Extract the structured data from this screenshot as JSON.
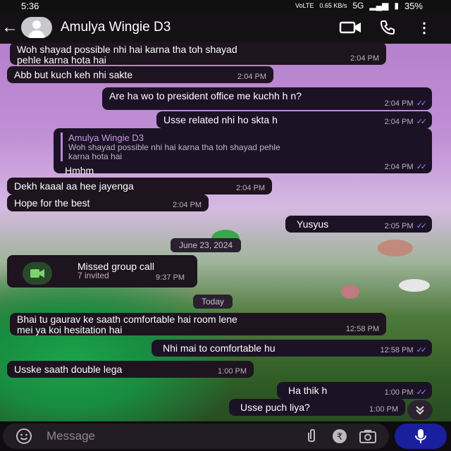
{
  "status_bar": {
    "time": "5:36",
    "network": "5G",
    "speed": "0.65 KB/s",
    "volte": "VoLTE",
    "battery": "35%"
  },
  "header": {
    "contact_name": "Amulya Wingie D3"
  },
  "messages": [
    {
      "text": "Woh shayad possible nhi hai karna tha toh shayad\npehle karna hota hai",
      "time": "2:04 PM"
    },
    {
      "text": "Abb but kuch keh nhi sakte",
      "time": "2:04 PM"
    },
    {
      "text": "Are ha wo to president office me kuchh h n?",
      "time": "2:04 PM"
    },
    {
      "text": "Usse related nhi ho skta h",
      "time": "2:04 PM"
    },
    {
      "quote_name": "Amulya Wingie D3",
      "quote_text": "Woh shayad possible nhi hai karna tha toh shayad pehle\nkarna hota hai",
      "text": "Hmhm",
      "time": "2:04 PM"
    },
    {
      "text": "Dekh kaaal aa hee jayenga",
      "time": "2:04 PM"
    },
    {
      "text": "Hope for the best",
      "time": "2:04 PM"
    },
    {
      "text": "Yusyus",
      "time": "2:05 PM"
    },
    {
      "text": "Bhai tu gaurav ke saath comfortable hai room lene\nmei ya koi hesitation hai",
      "time": "12:58 PM"
    },
    {
      "text": "Nhi mai to comfortable hu",
      "time": "12:58 PM"
    },
    {
      "text": "Usske saath double lega",
      "time": "1:00 PM"
    },
    {
      "text": "Ha thik h",
      "time": "1:00 PM"
    },
    {
      "text": "Usse puch liya?",
      "time": "1:00 PM"
    }
  ],
  "dates": {
    "first": "June 23, 2024",
    "second": "Today"
  },
  "call": {
    "title": "Missed group call",
    "subtitle": "7 invited",
    "time": "9:37 PM"
  },
  "input": {
    "placeholder": "Message"
  },
  "icons": [
    "back-arrow-icon",
    "avatar",
    "video-call-icon",
    "phone-icon",
    "more-icon",
    "emoji-icon",
    "attach-icon",
    "rupee-icon",
    "camera-icon",
    "mic-icon",
    "scroll-down-icon",
    "double-tick-icon"
  ],
  "colors": {
    "header": "#141114",
    "bubble": "#1d141f",
    "tick": "#8f86ff",
    "mic": "#1a1f9e"
  }
}
